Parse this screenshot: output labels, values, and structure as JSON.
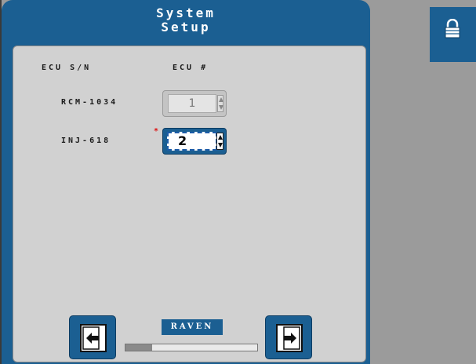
{
  "header": {
    "title_line1": "System",
    "title_line2": "Setup"
  },
  "table": {
    "col_serial": "ECU S/N",
    "col_number": "ECU #",
    "rows": [
      {
        "serial": "RCM-1034",
        "ecu_number": "1",
        "editable": false
      },
      {
        "serial": "INJ-618",
        "ecu_number": "2",
        "editable": true
      }
    ]
  },
  "required_marker": "*",
  "brand": {
    "logo_text": "RAVEN"
  },
  "progress": {
    "fraction": 0.2
  },
  "colors": {
    "panel_blue": "#1b5f92",
    "content_gray": "#d1d1d1",
    "background_gray": "#9b9b9b"
  },
  "icons": {
    "back": "exit-left-icon",
    "forward": "exit-right-icon",
    "lock": "padlock-icon"
  }
}
